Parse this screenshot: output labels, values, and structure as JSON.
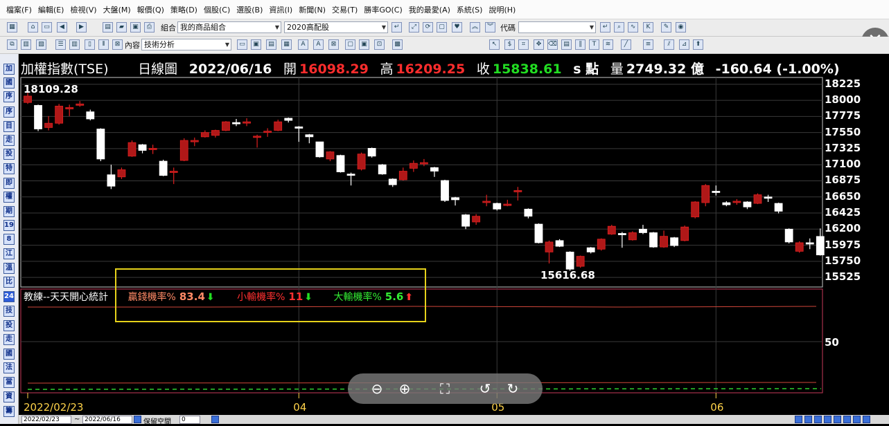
{
  "menu": [
    "檔案(F)",
    "編輯(E)",
    "檢視(V)",
    "大盤(M)",
    "報價(Q)",
    "策略(D)",
    "個股(C)",
    "選股(B)",
    "資訊(I)",
    "新聞(N)",
    "交易(T)",
    "勝率GO(C)",
    "我的最愛(A)",
    "系統(S)",
    "說明(H)"
  ],
  "toolbar1": {
    "group_label": "組合",
    "group_value": "我的商品組合",
    "portfolio_value": "2020高配股",
    "code_label": "代碼",
    "code_value": ""
  },
  "toolbar2": {
    "content_label": "內容",
    "content_value": "技術分析"
  },
  "sidebar": [
    "加",
    "國",
    "序",
    "序",
    "目",
    "走",
    "投",
    "特",
    "即",
    "權",
    "期",
    "19",
    "8",
    "江",
    "溫",
    "比",
    "24",
    "技",
    "投",
    "走",
    "國",
    "法",
    "當",
    "資",
    "籌"
  ],
  "chart_title": {
    "name": "加權指數(TSE)",
    "period": "日線圖",
    "date": "2022/06/16",
    "open_label": "開",
    "open": "16098.29",
    "high_label": "高",
    "high": "16209.25",
    "close_label": "收",
    "close": "15838.61",
    "unit": "s 點",
    "volume_label": "量",
    "volume": "2749.32 億",
    "change": "-160.64 (-1.00%)"
  },
  "colors": {
    "up": "#e02020",
    "up_fill": "#b01818",
    "down": "#ffffff",
    "close_color": "#22dd22",
    "highlight": "#e6d21a"
  },
  "indicator": {
    "name": "教練--天天開心統計",
    "win_label": "贏錢機率%",
    "win_value": "83.4",
    "win_arrow": "down",
    "small_loss_label": "小輸機率%",
    "small_loss_value": "11",
    "small_loss_arrow": "down",
    "big_loss_label": "大輸機率%",
    "big_loss_value": "5.6",
    "big_loss_arrow": "up",
    "ytick": "50"
  },
  "zoom_controls": [
    "zoom-out",
    "zoom-in",
    "fit",
    "rotate-left",
    "rotate-right"
  ],
  "bottom": {
    "date_from": "2022/02/23",
    "tilde": "~",
    "date_to": "2022/06/16",
    "keep_space_label": "保留空間",
    "keep_space_value": "0"
  },
  "chart_data": {
    "type": "candlestick",
    "ylim": [
      15420,
      18320
    ],
    "y_ticks": [
      18225,
      18000,
      17775,
      17550,
      17325,
      17100,
      16875,
      16650,
      16425,
      16200,
      15975,
      15750,
      15525
    ],
    "x_labels": [
      "2022/02/23",
      "04",
      "05",
      "06"
    ],
    "x_label_index": [
      0,
      26,
      45,
      66
    ],
    "max_label": "18109.28",
    "min_label": "15616.68",
    "max_index": 0,
    "min_index": 52,
    "candles": [
      {
        "o": 17970,
        "c": 18060,
        "h": 18109,
        "l": 17950
      },
      {
        "o": 17930,
        "c": 17600,
        "h": 17940,
        "l": 17570
      },
      {
        "o": 17620,
        "c": 17680,
        "h": 17780,
        "l": 17580
      },
      {
        "o": 17680,
        "c": 17920,
        "h": 17950,
        "l": 17660
      },
      {
        "o": 17880,
        "c": 17900,
        "h": 17940,
        "l": 17780
      },
      {
        "o": 17930,
        "c": 17950,
        "h": 17990,
        "l": 17910
      },
      {
        "o": 17840,
        "c": 17740,
        "h": 17870,
        "l": 17720
      },
      {
        "o": 17600,
        "c": 17180,
        "h": 17610,
        "l": 17150
      },
      {
        "o": 16960,
        "c": 16800,
        "h": 17100,
        "l": 16760
      },
      {
        "o": 16930,
        "c": 17030,
        "h": 17060,
        "l": 16900
      },
      {
        "o": 17220,
        "c": 17410,
        "h": 17440,
        "l": 17210
      },
      {
        "o": 17380,
        "c": 17300,
        "h": 17390,
        "l": 17260
      },
      {
        "o": 17310,
        "c": 17330,
        "h": 17380,
        "l": 17250
      },
      {
        "o": 17150,
        "c": 16950,
        "h": 17170,
        "l": 16940
      },
      {
        "o": 17000,
        "c": 17010,
        "h": 17060,
        "l": 16830
      },
      {
        "o": 17160,
        "c": 17440,
        "h": 17470,
        "l": 17150
      },
      {
        "o": 17420,
        "c": 17440,
        "h": 17480,
        "l": 17360
      },
      {
        "o": 17490,
        "c": 17550,
        "h": 17580,
        "l": 17480
      },
      {
        "o": 17510,
        "c": 17580,
        "h": 17590,
        "l": 17480
      },
      {
        "o": 17580,
        "c": 17700,
        "h": 17710,
        "l": 17570
      },
      {
        "o": 17690,
        "c": 17680,
        "h": 17740,
        "l": 17640
      },
      {
        "o": 17690,
        "c": 17700,
        "h": 17750,
        "l": 17640
      },
      {
        "o": 17500,
        "c": 17500,
        "h": 17520,
        "l": 17340
      },
      {
        "o": 17550,
        "c": 17570,
        "h": 17610,
        "l": 17490
      },
      {
        "o": 17580,
        "c": 17700,
        "h": 17730,
        "l": 17570
      },
      {
        "o": 17750,
        "c": 17720,
        "h": 17760,
        "l": 17690
      },
      {
        "o": 17630,
        "c": 17610,
        "h": 17640,
        "l": 17420
      },
      {
        "o": 17520,
        "c": 17490,
        "h": 17530,
        "l": 17400
      },
      {
        "o": 17420,
        "c": 17210,
        "h": 17420,
        "l": 17200
      },
      {
        "o": 17180,
        "c": 17280,
        "h": 17290,
        "l": 17150
      },
      {
        "o": 17230,
        "c": 17000,
        "h": 17240,
        "l": 16990
      },
      {
        "o": 16970,
        "c": 16960,
        "h": 16990,
        "l": 16810
      },
      {
        "o": 17040,
        "c": 17250,
        "h": 17270,
        "l": 17020
      },
      {
        "o": 17330,
        "c": 17220,
        "h": 17340,
        "l": 17200
      },
      {
        "o": 17100,
        "c": 16970,
        "h": 17110,
        "l": 16960
      },
      {
        "o": 16900,
        "c": 16820,
        "h": 16910,
        "l": 16790
      },
      {
        "o": 16890,
        "c": 17010,
        "h": 17060,
        "l": 16880
      },
      {
        "o": 17050,
        "c": 17120,
        "h": 17160,
        "l": 17000
      },
      {
        "o": 17120,
        "c": 17130,
        "h": 17180,
        "l": 17080
      },
      {
        "o": 17060,
        "c": 17010,
        "h": 17070,
        "l": 16930
      },
      {
        "o": 16880,
        "c": 16600,
        "h": 16890,
        "l": 16580
      },
      {
        "o": 16640,
        "c": 16610,
        "h": 16650,
        "l": 16530
      },
      {
        "o": 16400,
        "c": 16240,
        "h": 16410,
        "l": 16200
      },
      {
        "o": 16300,
        "c": 16380,
        "h": 16410,
        "l": 16260
      },
      {
        "o": 16580,
        "c": 16590,
        "h": 16680,
        "l": 16520
      },
      {
        "o": 16560,
        "c": 16480,
        "h": 16570,
        "l": 16460
      },
      {
        "o": 16530,
        "c": 16550,
        "h": 16610,
        "l": 16520
      },
      {
        "o": 16730,
        "c": 16740,
        "h": 16790,
        "l": 16600
      },
      {
        "o": 16480,
        "c": 16380,
        "h": 16490,
        "l": 16350
      },
      {
        "o": 16270,
        "c": 16010,
        "h": 16280,
        "l": 16000
      },
      {
        "o": 15880,
        "c": 16020,
        "h": 16040,
        "l": 15720
      },
      {
        "o": 16040,
        "c": 15960,
        "h": 16060,
        "l": 15950
      },
      {
        "o": 15880,
        "c": 15640,
        "h": 15890,
        "l": 15617
      },
      {
        "o": 15680,
        "c": 15820,
        "h": 15830,
        "l": 15660
      },
      {
        "o": 15940,
        "c": 15880,
        "h": 15950,
        "l": 15860
      },
      {
        "o": 15920,
        "c": 16060,
        "h": 16070,
        "l": 15900
      },
      {
        "o": 16130,
        "c": 16240,
        "h": 16260,
        "l": 16120
      },
      {
        "o": 16140,
        "c": 16120,
        "h": 16160,
        "l": 15940
      },
      {
        "o": 16050,
        "c": 16150,
        "h": 16170,
        "l": 16040
      },
      {
        "o": 16200,
        "c": 16150,
        "h": 16260,
        "l": 16130
      },
      {
        "o": 16150,
        "c": 15950,
        "h": 16160,
        "l": 15940
      },
      {
        "o": 15950,
        "c": 16100,
        "h": 16180,
        "l": 15940
      },
      {
        "o": 16080,
        "c": 15970,
        "h": 16090,
        "l": 15950
      },
      {
        "o": 16040,
        "c": 16230,
        "h": 16250,
        "l": 16030
      },
      {
        "o": 16370,
        "c": 16580,
        "h": 16590,
        "l": 16350
      },
      {
        "o": 16570,
        "c": 16810,
        "h": 16830,
        "l": 16520
      },
      {
        "o": 16730,
        "c": 16720,
        "h": 16810,
        "l": 16670
      },
      {
        "o": 16570,
        "c": 16540,
        "h": 16590,
        "l": 16520
      },
      {
        "o": 16590,
        "c": 16590,
        "h": 16620,
        "l": 16540
      },
      {
        "o": 16580,
        "c": 16510,
        "h": 16590,
        "l": 16480
      },
      {
        "o": 16560,
        "c": 16680,
        "h": 16700,
        "l": 16550
      },
      {
        "o": 16650,
        "c": 16640,
        "h": 16680,
        "l": 16580
      },
      {
        "o": 16560,
        "c": 16450,
        "h": 16570,
        "l": 16420
      },
      {
        "o": 16200,
        "c": 16020,
        "h": 16210,
        "l": 16000
      },
      {
        "o": 15890,
        "c": 16010,
        "h": 16030,
        "l": 15870
      },
      {
        "o": 16010,
        "c": 16000,
        "h": 16070,
        "l": 15920
      },
      {
        "o": 16098,
        "c": 15839,
        "h": 16209,
        "l": 15830
      }
    ]
  }
}
